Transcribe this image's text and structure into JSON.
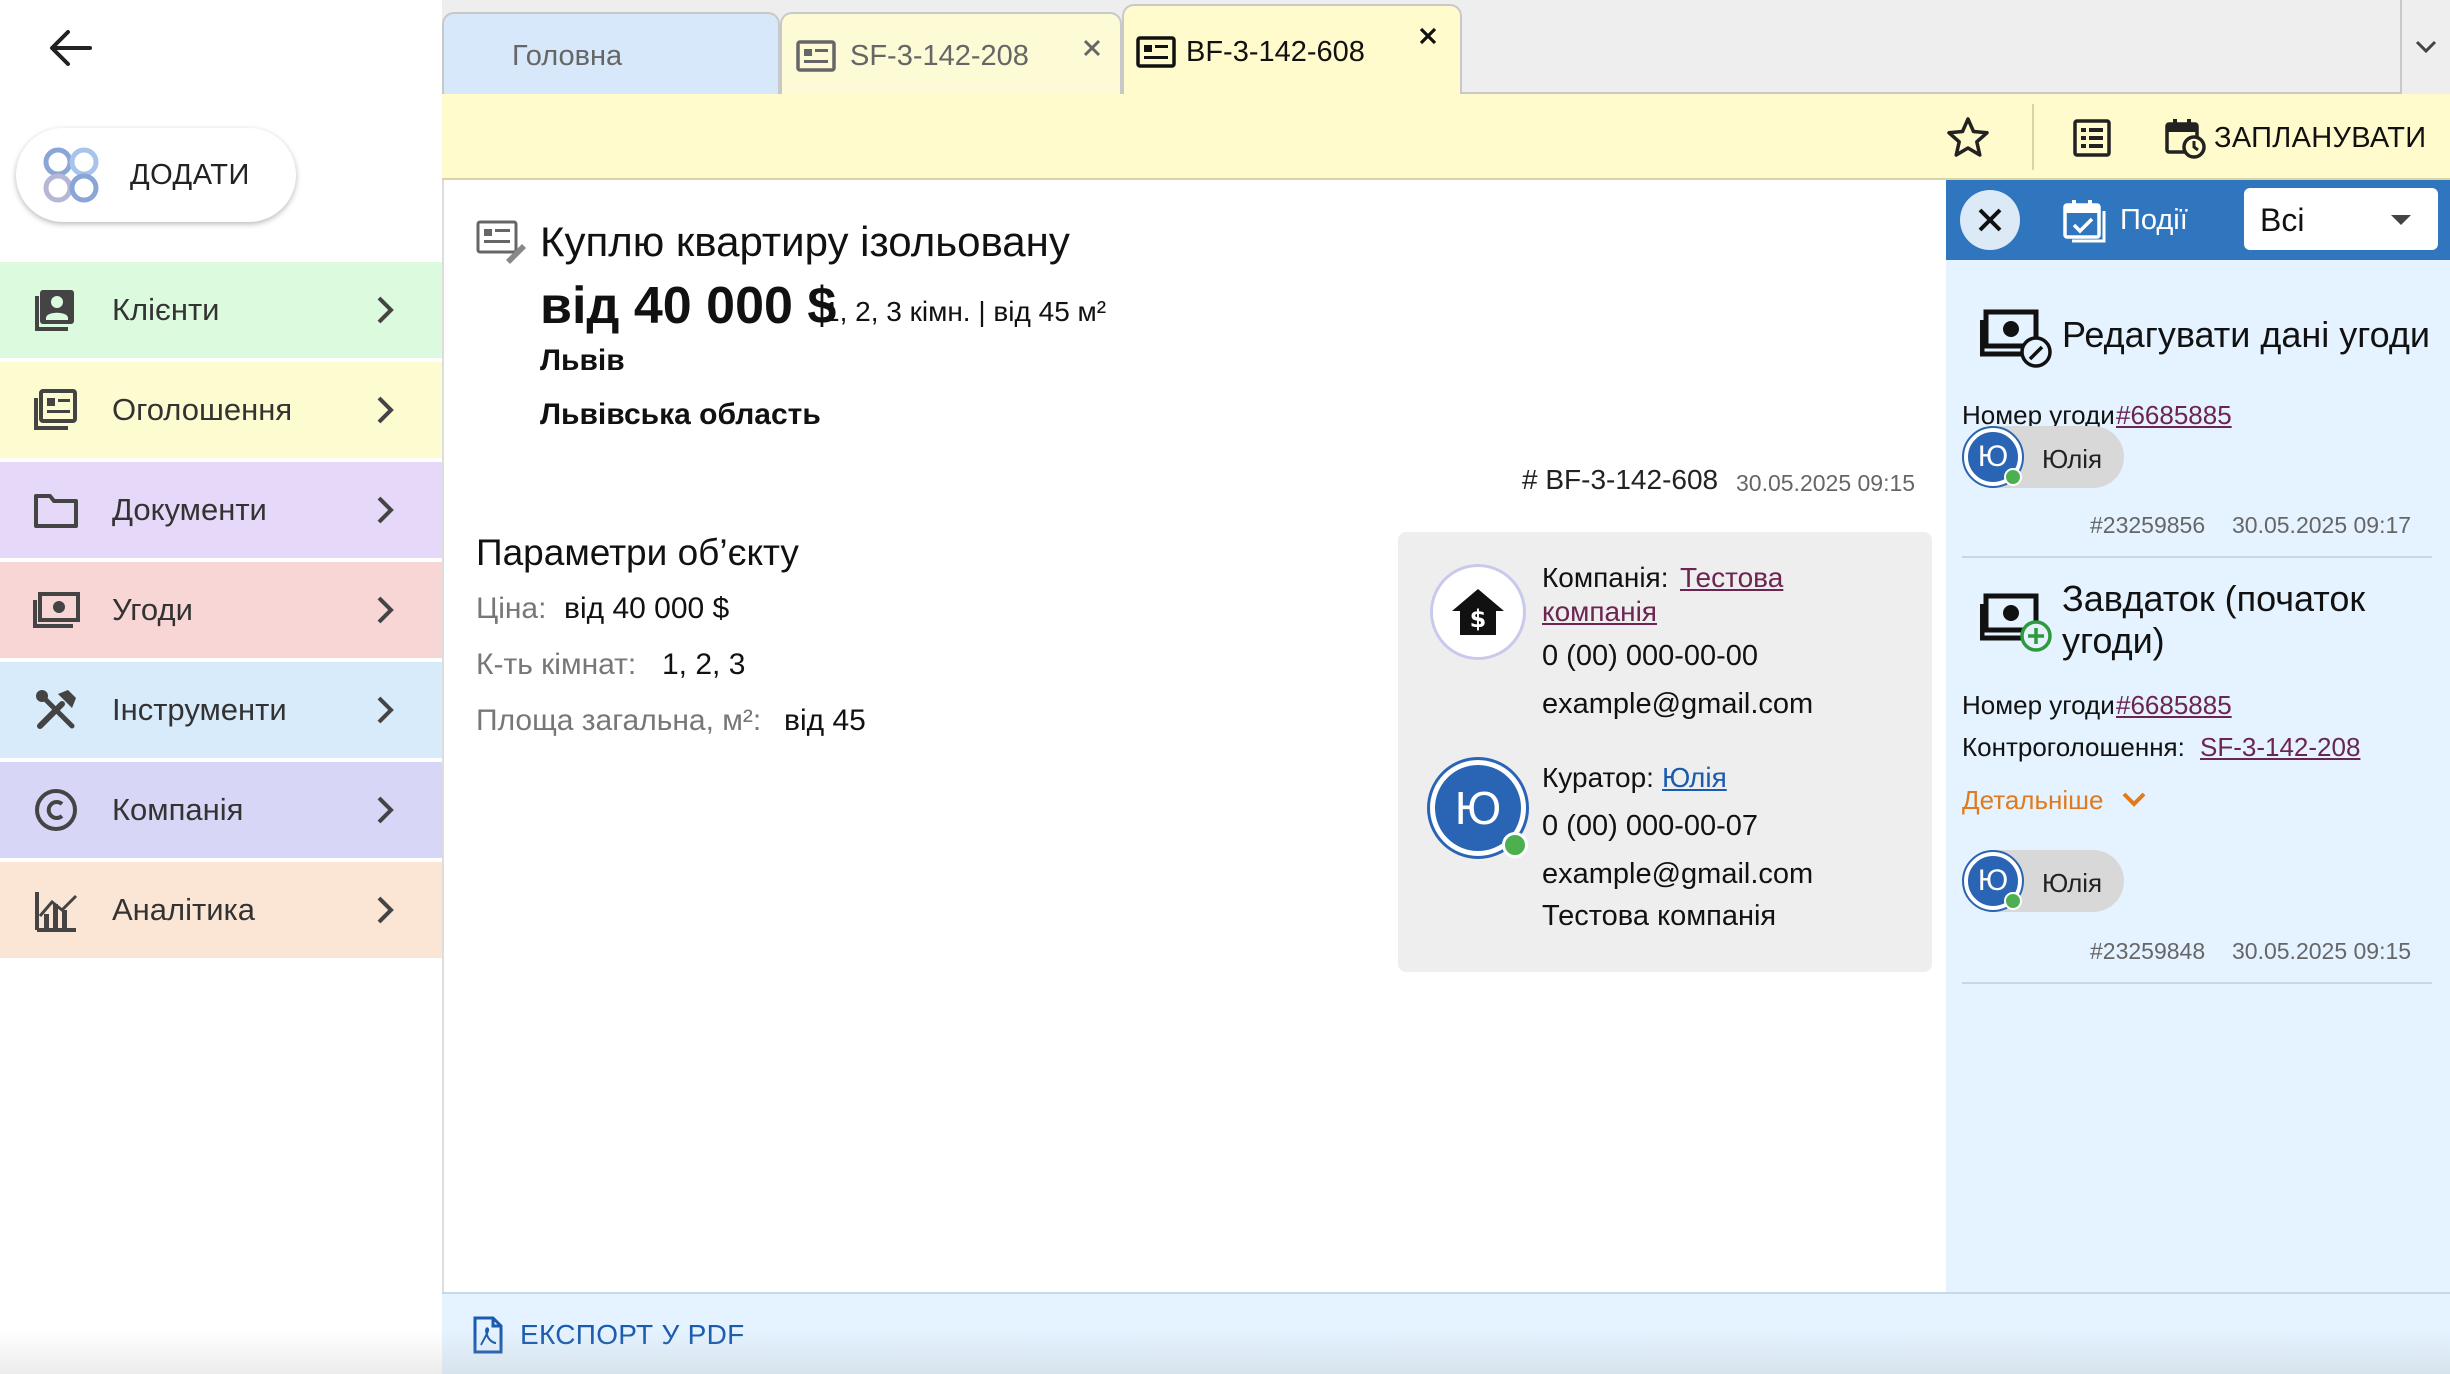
{
  "sidebar": {
    "back_icon": "arrow-left-icon",
    "add_button": {
      "label": "ДОДАТИ",
      "icon": "add-logo-icon"
    },
    "items": [
      {
        "label": "Клієнти",
        "icon": "contacts-icon",
        "color": "#dcfadd"
      },
      {
        "label": "Оголошення",
        "icon": "listings-icon",
        "color": "#fdfbd0"
      },
      {
        "label": "Документи",
        "icon": "folder-icon",
        "color": "#e6d8f8"
      },
      {
        "label": "Угоди",
        "icon": "money-icon",
        "color": "#f8d6d6"
      },
      {
        "label": "Інструменти",
        "icon": "tools-icon",
        "color": "#d8ebfb"
      },
      {
        "label": "Компанія",
        "icon": "copyright-icon",
        "color": "#d8d6f6"
      },
      {
        "label": "Аналітика",
        "icon": "analytics-icon",
        "color": "#fbe6d6"
      }
    ]
  },
  "tabs": [
    {
      "label": "Головна",
      "color": "#d6e8fa"
    },
    {
      "label": "SF-3-142-208",
      "color": "#fcfbd6",
      "close_icon": "close-icon"
    },
    {
      "label": "BF-3-142-608",
      "color": "#fffbcc",
      "close_icon": "close-icon",
      "active": true
    }
  ],
  "toolbar": {
    "favorite_icon": "star-icon",
    "table_icon": "table-icon",
    "schedule_label": "ЗАПЛАНУВАТИ",
    "schedule_icon": "calendar-clock-icon"
  },
  "listing": {
    "title": "Куплю квартиру ізольовану",
    "price": "від 40 000 $",
    "details": "1, 2, 3 кімн. | від 45 м²",
    "city": "Львів",
    "region": "Львівська область",
    "id_label": "# BF-3-142-608",
    "date": "30.05.2025 09:15"
  },
  "params": {
    "heading": "Параметри об’єкту",
    "rows": [
      {
        "label": "Ціна:",
        "value": "від 40 000 $"
      },
      {
        "label": "К-ть кімнат:",
        "value": "1, 2, 3"
      },
      {
        "label": "Площа загальна, м²:",
        "value": "від 45"
      }
    ]
  },
  "contacts": {
    "company": {
      "label": "Компанія:",
      "name_line1": "Тестова",
      "name_line2": "компанія",
      "phone": "0 (00) 000-00-00",
      "email": "example@gmail.com"
    },
    "curator": {
      "label": "Куратор:",
      "name": "Юлія",
      "avatar": "Ю",
      "phone": "0 (00) 000-00-07",
      "email": "example@gmail.com",
      "company": "Тестова компанія"
    }
  },
  "events": {
    "tab_label": "Події",
    "filter_value": "Всі",
    "items": [
      {
        "title": "Редагувати дані угоди",
        "deal_label": "Номер угоди",
        "deal_link": "#6685885",
        "user_avatar": "Ю",
        "user_name": "Юлія",
        "ref": "#23259856",
        "date": "30.05.2025 09:17"
      },
      {
        "title_line1": "Завдаток (початок",
        "title_line2": "угоди)",
        "deal_label": "Номер угоди",
        "deal_link": "#6685885",
        "counter_label": "Контроголошення:",
        "counter_link": "SF-3-142-208",
        "more_label": "Детальніше",
        "user_avatar": "Ю",
        "user_name": "Юлія",
        "ref": "#23259848",
        "date": "30.05.2025 09:15"
      }
    ]
  },
  "footer": {
    "export_label": "ЕКСПОРТ У PDF",
    "export_icon": "pdf-icon"
  }
}
